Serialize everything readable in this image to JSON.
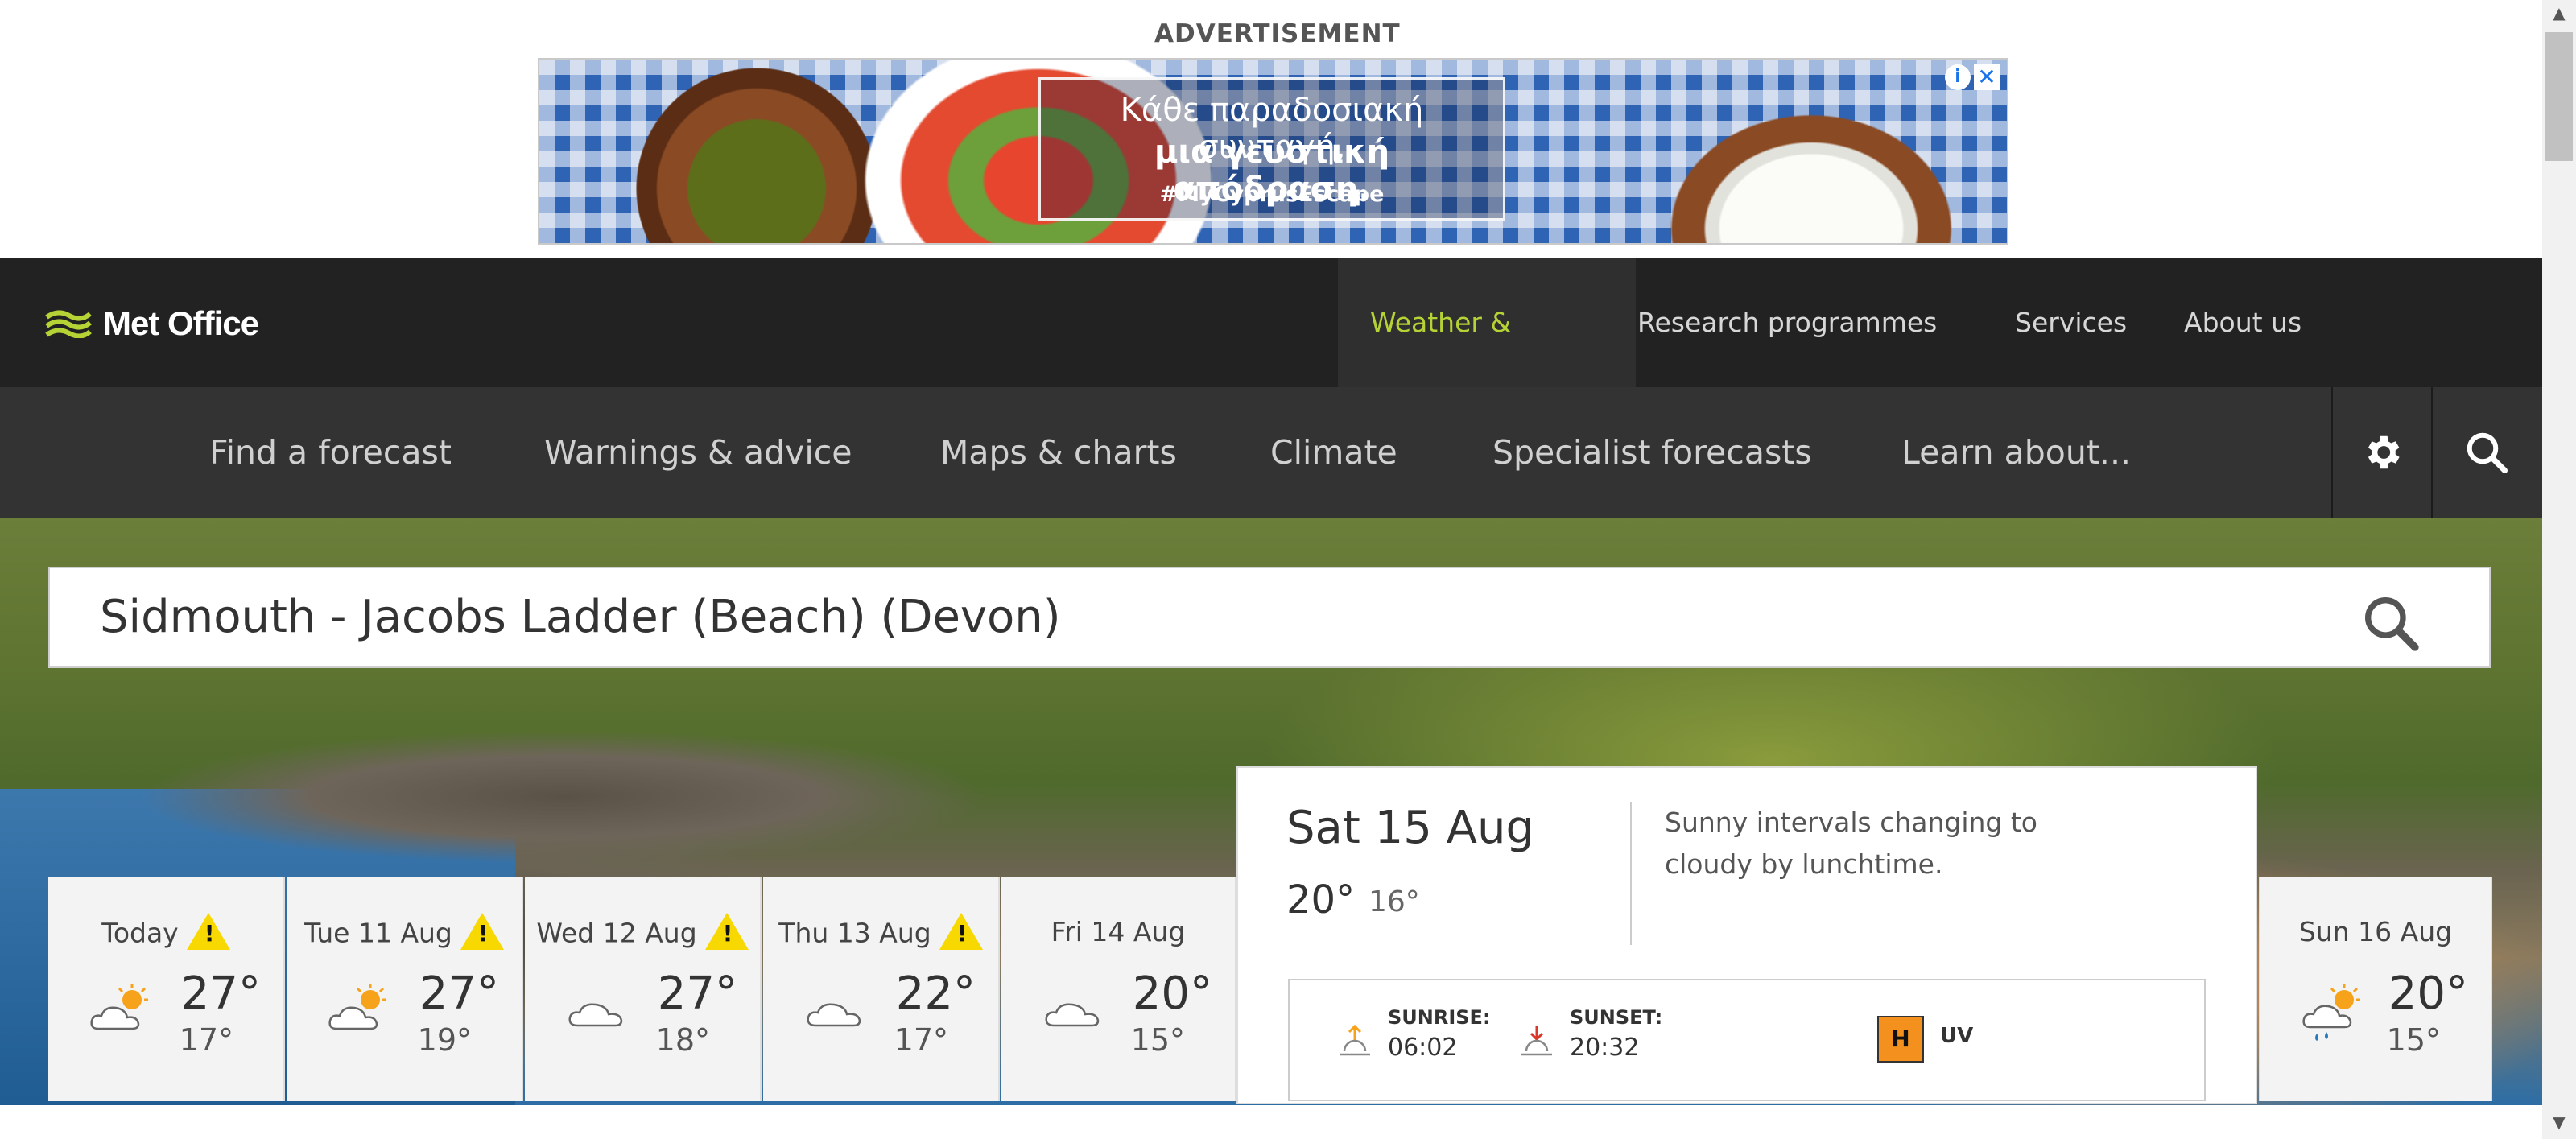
{
  "advertisement": {
    "label": "ADVERTISEMENT",
    "line1": "Κάθε παραδοσιακή συνταγή,",
    "line2": "μια γευστική απόδραση.",
    "hashtag": "#MyCyprusEscape"
  },
  "header": {
    "logo_text": "Met Office",
    "top_nav": [
      "Weather & climate",
      "Research programmes",
      "Services",
      "About us"
    ],
    "active_top_nav": "Weather & climate",
    "sub_nav": [
      "Find a forecast",
      "Warnings & advice",
      "Maps & charts",
      "Climate",
      "Specialist forecasts",
      "Learn about..."
    ]
  },
  "location": {
    "name": "Sidmouth - Jacobs Ladder (Beach) (Devon)"
  },
  "forecast": {
    "days": [
      {
        "label": "Today",
        "warning": true,
        "icon": "sunny-intervals-icon",
        "high": "27°",
        "low": "17°"
      },
      {
        "label": "Tue 11 Aug",
        "warning": true,
        "icon": "sunny-intervals-icon",
        "high": "27°",
        "low": "19°"
      },
      {
        "label": "Wed 12 Aug",
        "warning": true,
        "icon": "cloudy-icon",
        "high": "27°",
        "low": "18°"
      },
      {
        "label": "Thu 13 Aug",
        "warning": true,
        "icon": "cloudy-icon",
        "high": "22°",
        "low": "17°"
      },
      {
        "label": "Fri 14 Aug",
        "warning": false,
        "icon": "cloudy-icon",
        "high": "20°",
        "low": "15°"
      },
      {
        "label": "Sun 16 Aug",
        "warning": false,
        "icon": "light-rain-sun-icon",
        "high": "20°",
        "low": "15°"
      }
    ],
    "selected": {
      "date": "Sat 15 Aug",
      "high": "20°",
      "low": "16°",
      "summary": "Sunny intervals changing to cloudy by lunchtime.",
      "sunrise_label": "SUNRISE:",
      "sunrise": "06:02",
      "sunset_label": "SUNSET:",
      "sunset": "20:32",
      "uv_level": "H",
      "uv_label": "UV"
    }
  },
  "colors": {
    "header_bg": "#222222",
    "subnav_bg": "#333333",
    "accent": "#b5d334",
    "warning": "#f7d800",
    "uv_high": "#f4911e"
  }
}
